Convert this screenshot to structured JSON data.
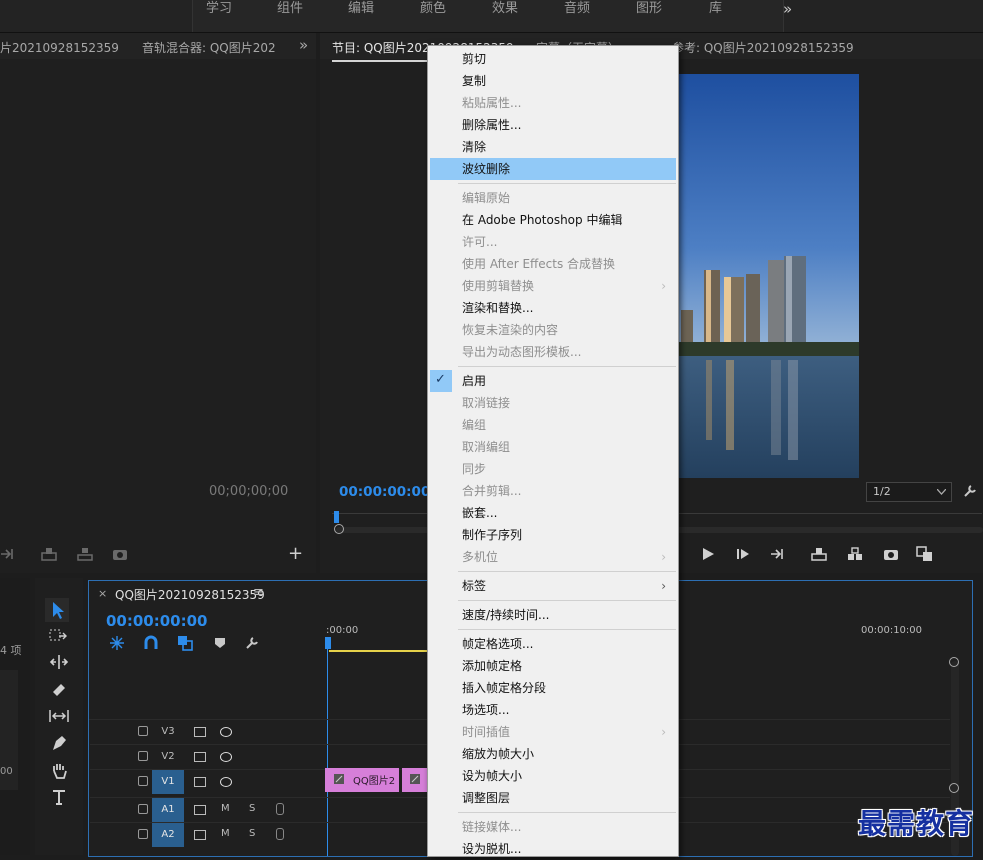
{
  "workspace_tabs": [
    "学习",
    "组件",
    "编辑",
    "颜色",
    "效果",
    "音频",
    "图形",
    "库"
  ],
  "workspace_more": "»",
  "source_panel": {
    "tab_clip": "片20210928152359",
    "tab_mixer": "音轨混合器: QQ图片202",
    "more": "»",
    "timecode": "00;00;00;00",
    "plus": "+"
  },
  "program_panel": {
    "tab_program": "节目: QQ图片20210928152359",
    "tab_caption": "字幕（无字幕）",
    "tab_reference": "参考: QQ图片20210928152359",
    "timecode": "00:00:00:00",
    "resolution": "1/2"
  },
  "project_panel": {
    "items_count": "4 项",
    "side_value": "00"
  },
  "timeline": {
    "close": "×",
    "sequence_name": "QQ图片20210928152359",
    "menu_icon": "≡",
    "timecode": "00:00:00:00",
    "ruler_start": ":00:00",
    "ruler_end": "00:00:10:00",
    "tracks": [
      {
        "name": "V3",
        "type": "video"
      },
      {
        "name": "V2",
        "type": "video"
      },
      {
        "name": "V1",
        "type": "video"
      },
      {
        "name": "A1",
        "type": "audio",
        "m": "M",
        "s": "S"
      },
      {
        "name": "A2",
        "type": "audio",
        "m": "M",
        "s": "S"
      }
    ],
    "clip_label": "QQ图片2"
  },
  "context_menu": {
    "items": [
      {
        "label": "剪切",
        "state": "enabled"
      },
      {
        "label": "复制",
        "state": "enabled"
      },
      {
        "label": "粘贴属性...",
        "state": "disabled"
      },
      {
        "label": "删除属性...",
        "state": "enabled"
      },
      {
        "label": "清除",
        "state": "enabled"
      },
      {
        "label": "波纹删除",
        "state": "highlighted"
      },
      {
        "label": "编辑原始",
        "state": "disabled"
      },
      {
        "label": "在 Adobe Photoshop 中编辑",
        "state": "enabled"
      },
      {
        "label": "许可...",
        "state": "disabled"
      },
      {
        "label": "使用 After Effects 合成替换",
        "state": "disabled"
      },
      {
        "label": "使用剪辑替换",
        "state": "disabled",
        "submenu": true
      },
      {
        "label": "渲染和替换...",
        "state": "enabled"
      },
      {
        "label": "恢复未渲染的内容",
        "state": "disabled"
      },
      {
        "label": "导出为动态图形模板...",
        "state": "disabled"
      },
      {
        "label": "启用",
        "state": "checked"
      },
      {
        "label": "取消链接",
        "state": "disabled"
      },
      {
        "label": "编组",
        "state": "disabled"
      },
      {
        "label": "取消编组",
        "state": "disabled"
      },
      {
        "label": "同步",
        "state": "disabled"
      },
      {
        "label": "合并剪辑...",
        "state": "disabled"
      },
      {
        "label": "嵌套...",
        "state": "enabled"
      },
      {
        "label": "制作子序列",
        "state": "enabled"
      },
      {
        "label": "多机位",
        "state": "disabled",
        "submenu": true
      },
      {
        "label": "标签",
        "state": "enabled",
        "submenu": true
      },
      {
        "label": "速度/持续时间...",
        "state": "enabled"
      },
      {
        "label": "帧定格选项...",
        "state": "enabled"
      },
      {
        "label": "添加帧定格",
        "state": "enabled"
      },
      {
        "label": "插入帧定格分段",
        "state": "enabled"
      },
      {
        "label": "场选项...",
        "state": "enabled"
      },
      {
        "label": "时间插值",
        "state": "disabled",
        "submenu": true
      },
      {
        "label": "缩放为帧大小",
        "state": "enabled"
      },
      {
        "label": "设为帧大小",
        "state": "enabled"
      },
      {
        "label": "调整图层",
        "state": "enabled"
      },
      {
        "label": "链接媒体...",
        "state": "disabled"
      },
      {
        "label": "设为脱机...",
        "state": "enabled"
      }
    ],
    "submenu_arrow": "›",
    "check_mark": "✓"
  },
  "watermark": "最需教育",
  "colors": {
    "accent_blue": "#2d8ceb",
    "menu_highlight": "#91c9f7",
    "clip_pink": "#d67fd9",
    "playhead_yellow": "#e6d24a"
  }
}
